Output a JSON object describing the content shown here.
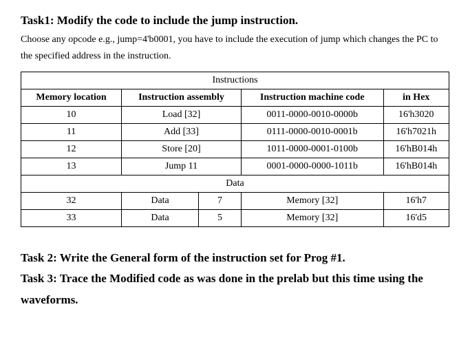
{
  "task1": {
    "heading": "Task1: Modify the code to include the jump instruction.",
    "paragraph": "Choose any opcode e.g., jump=4'b0001, you have to include the execution of jump which changes the PC to the specified address in the instruction."
  },
  "table": {
    "sections": {
      "instructions": "Instructions",
      "data": "Data"
    },
    "headers": {
      "memloc": "Memory location",
      "assembly": "Instruction assembly",
      "machinecode": "Instruction machine code",
      "inhex": "in Hex"
    },
    "instructions": [
      {
        "memloc": "10",
        "assembly": "Load [32]",
        "machinecode": "0011-0000-0010-0000b",
        "inhex": "16'h3020"
      },
      {
        "memloc": "11",
        "assembly": "Add [33]",
        "machinecode": "0111-0000-0010-0001b",
        "inhex": "16'h7021h"
      },
      {
        "memloc": "12",
        "assembly": "Store [20]",
        "machinecode": "1011-0000-0001-0100b",
        "inhex": "16'hB014h"
      },
      {
        "memloc": "13",
        "assembly": "Jump 11",
        "machinecode": "0001-0000-0000-1011b",
        "inhex": "16'hB014h"
      }
    ],
    "data": [
      {
        "memloc": "32",
        "label": "Data",
        "value": "7",
        "desc": "Memory [32]",
        "inhex": "16'h7"
      },
      {
        "memloc": "33",
        "label": "Data",
        "value": "5",
        "desc": "Memory [32]",
        "inhex": "16'd5"
      }
    ]
  },
  "task2": {
    "heading": "Task 2: Write the General form of the instruction set for Prog #1."
  },
  "task3": {
    "heading": "Task 3: Trace the Modified code as was done in the prelab but this time using the waveforms."
  }
}
